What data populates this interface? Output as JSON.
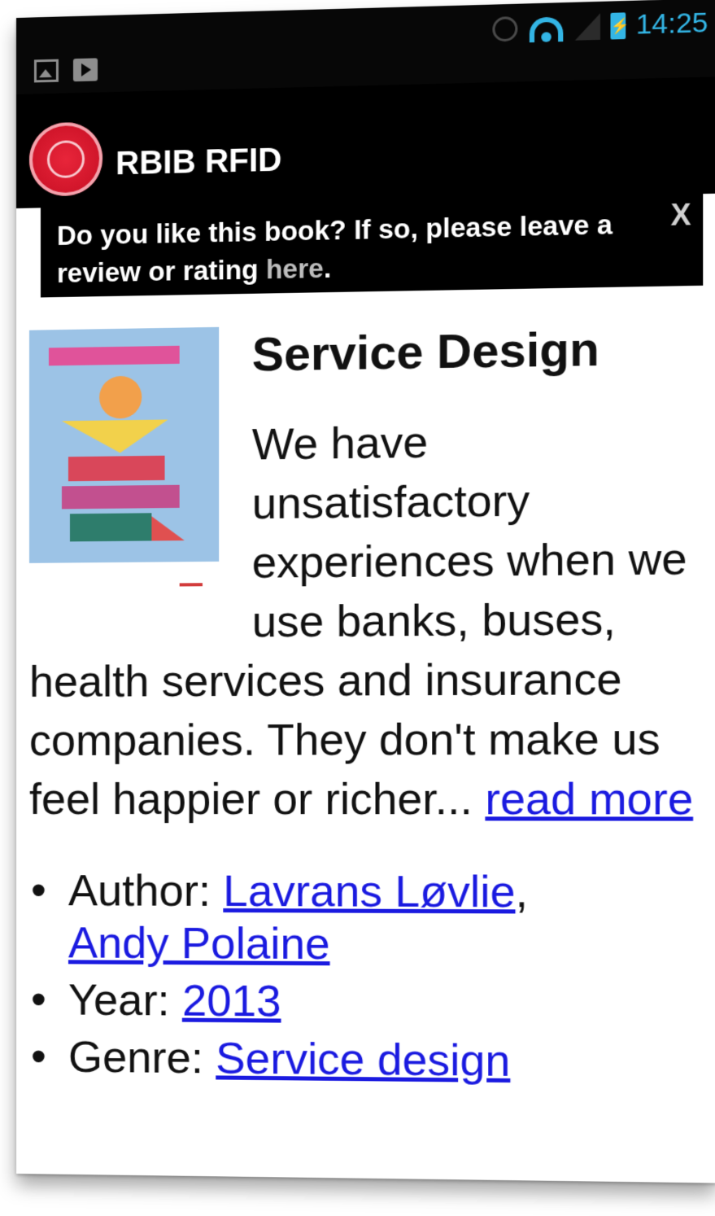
{
  "status_bar": {
    "time": "14:25",
    "left_icons": [
      "image-icon",
      "play-store-icon"
    ],
    "right_icons": [
      "alarm-icon",
      "wifi-icon",
      "signal-icon",
      "battery-charging-icon"
    ],
    "accent_color": "#33b5e5"
  },
  "action_bar": {
    "title": "RBIB RFID",
    "logo_color": "#d2162b"
  },
  "banner": {
    "text_before": "Do you like this book? If so, please leave a review or rating ",
    "link_text": "here",
    "text_after": ".",
    "close_label": "X"
  },
  "book": {
    "title": "Service Design",
    "description": "We have unsatisfactory experiences when we use banks, buses, health services and insurance companies. They don't make us feel happier or richer... ",
    "read_more": "read more",
    "details": {
      "author_label": "Author: ",
      "authors": [
        "Lavrans Løvlie",
        "Andy Polaine"
      ],
      "author_separator": ",",
      "year_label": "Year: ",
      "year": "2013",
      "genre_label": "Genre: ",
      "genre": "Service design"
    }
  },
  "colors": {
    "link": "#1a1ae0",
    "background": "#ffffff",
    "bar": "#000000"
  }
}
